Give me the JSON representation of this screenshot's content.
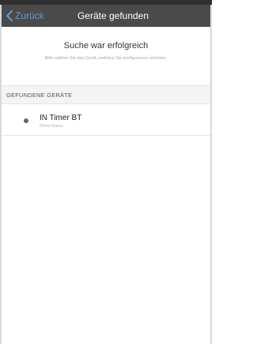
{
  "nav": {
    "back_label": "Zurück",
    "title": "Geräte gefunden",
    "back_icon": "chevron-left-icon",
    "accent_color": "#5a9ed6",
    "bar_color": "#4a4a4a"
  },
  "result": {
    "title": "Suche war erfolgreich",
    "subtitle": "Bitte wählen Sie das Gerät, welches Sie konfigurieren möchten."
  },
  "devices_section": {
    "header": "GEFUNDENE GERÄTE",
    "items": [
      {
        "name": "IN Timer BT",
        "room": "Ohne Raum",
        "status_icon": "status-dot-icon"
      }
    ]
  }
}
